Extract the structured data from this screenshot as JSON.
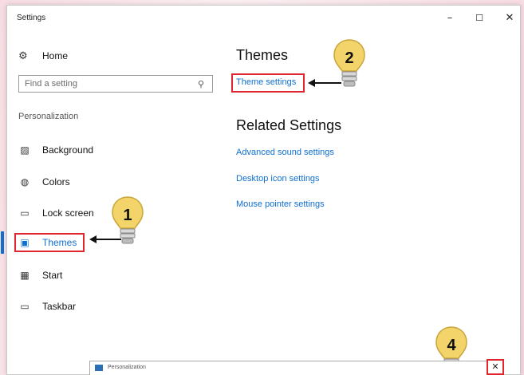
{
  "window": {
    "title": "Settings",
    "minimize_glyph": "–",
    "maximize_glyph": "☐",
    "close_glyph": "✕"
  },
  "sidebar": {
    "home_label": "Home",
    "search_placeholder": "Find a setting",
    "section": "Personalization",
    "items": [
      {
        "label": "Background",
        "icon": "background-icon"
      },
      {
        "label": "Colors",
        "icon": "colors-icon"
      },
      {
        "label": "Lock screen",
        "icon": "lock-screen-icon"
      },
      {
        "label": "Themes",
        "icon": "themes-icon",
        "active": true
      },
      {
        "label": "Start",
        "icon": "start-icon"
      },
      {
        "label": "Taskbar",
        "icon": "taskbar-icon"
      }
    ]
  },
  "main": {
    "themes_heading": "Themes",
    "theme_settings_link": "Theme settings",
    "related_heading": "Related Settings",
    "related_links": [
      "Advanced sound settings",
      "Desktop icon settings",
      "Mouse pointer settings"
    ]
  },
  "callouts": [
    "1",
    "2",
    "4"
  ],
  "mini_window": {
    "title": "Personalization",
    "close_glyph": "✕"
  },
  "colors": {
    "accent": "#0f6fd0",
    "highlight_box": "#e0252c",
    "bulb": "#f2d46a"
  }
}
